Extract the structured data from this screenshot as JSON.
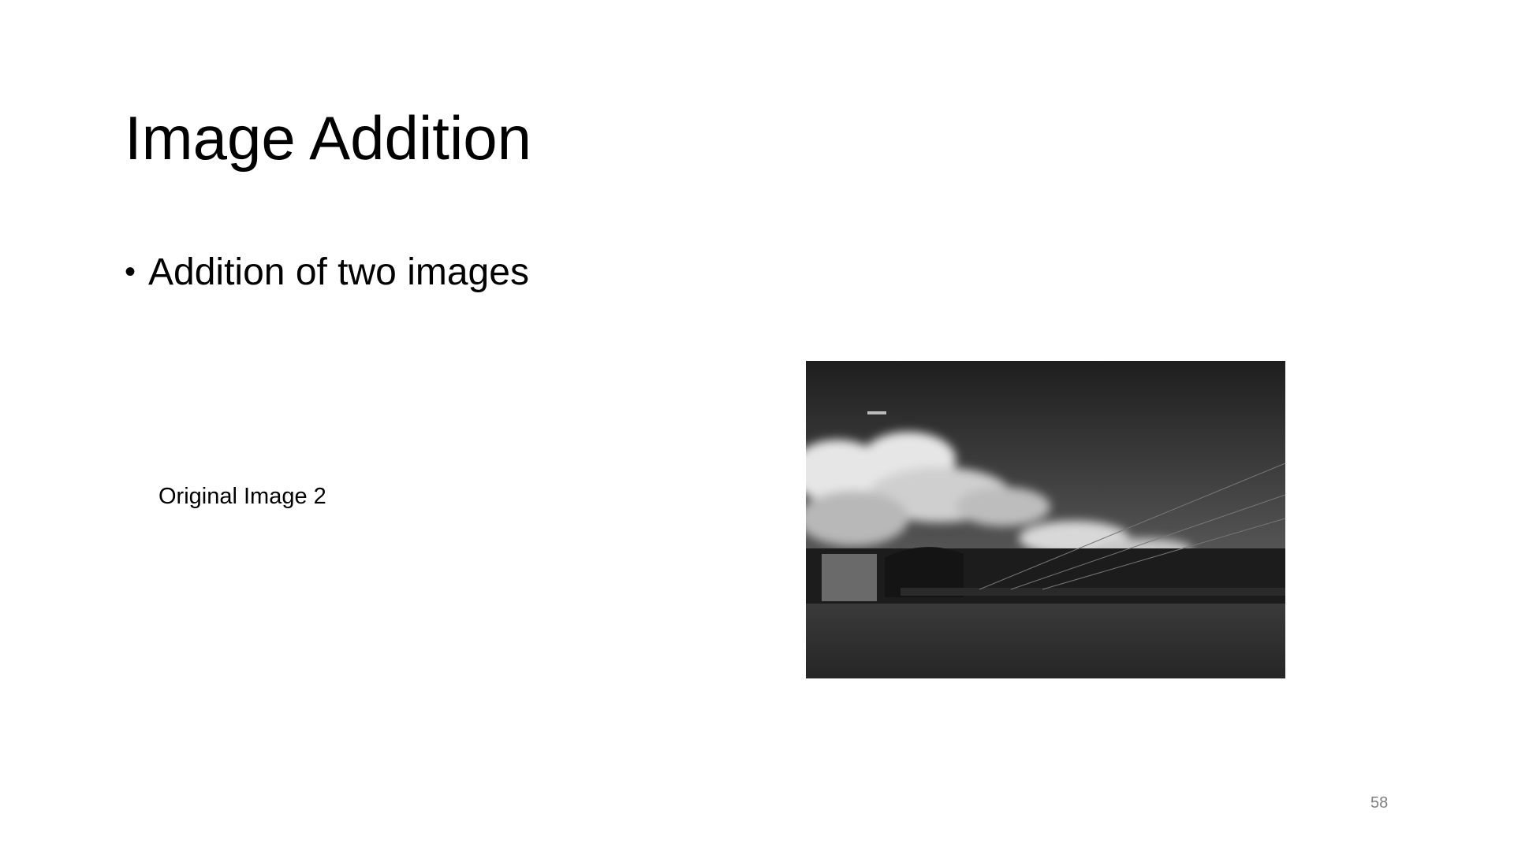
{
  "slide": {
    "title": "Image Addition",
    "bullets": [
      "Addition of two images"
    ],
    "image_label": "Original Image 2",
    "page_number": "58"
  }
}
